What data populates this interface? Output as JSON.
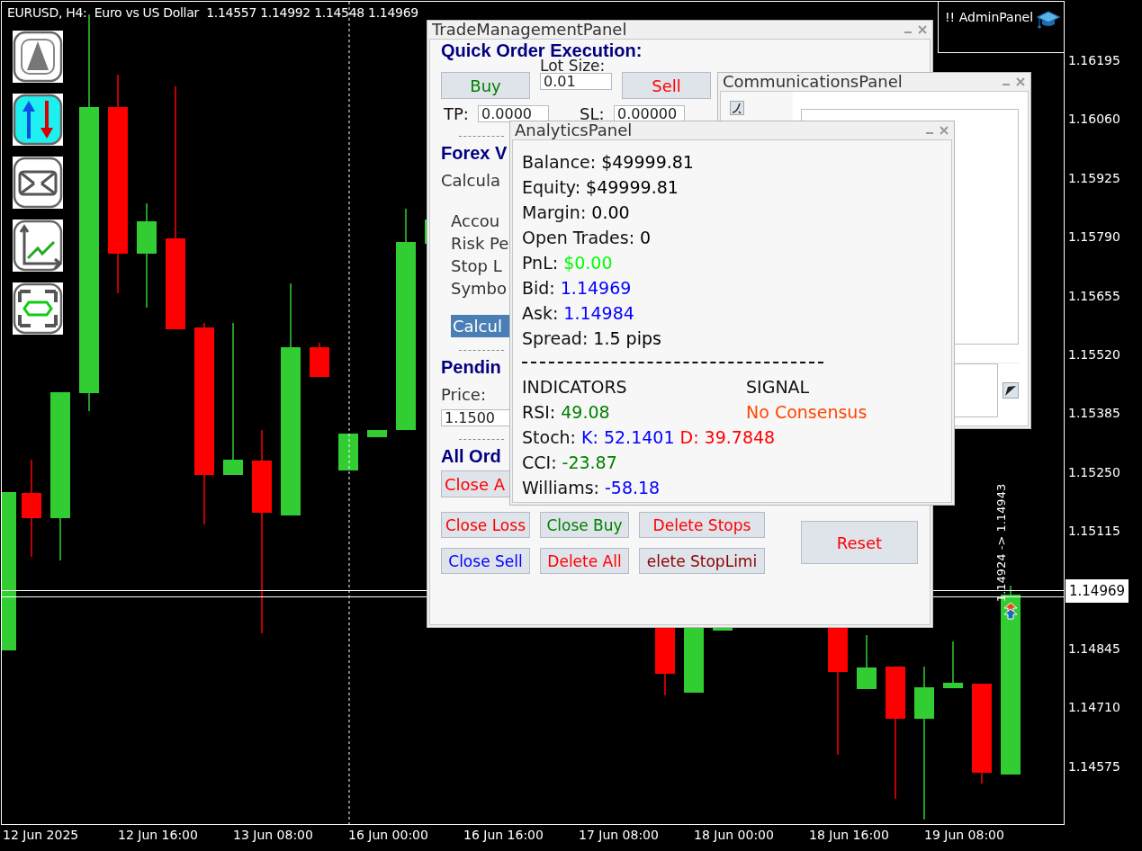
{
  "chart": {
    "header": "EURUSD, H4:  Euro vs US Dollar  1.14557 1.14992 1.14548 1.14969",
    "admin_label": "!! AdminPanel",
    "price_labels": [
      "1.16195",
      "1.16060",
      "1.15925",
      "1.15790",
      "1.15655",
      "1.15520",
      "1.15385",
      "1.15250",
      "1.15115",
      "1.14845",
      "1.14710",
      "1.14575"
    ],
    "current_price": "1.14969",
    "trade_line_label": "1.14924 -> 1.14943",
    "time_labels": [
      "12 Jun 2025",
      "12 Jun 16:00",
      "13 Jun 08:00",
      "16 Jun 00:00",
      "16 Jun 16:00",
      "17 Jun 08:00",
      "18 Jun 00:00",
      "18 Jun 16:00",
      "19 Jun 08:00"
    ]
  },
  "toolbar": [
    {
      "kind": "up",
      "selected": false
    },
    {
      "kind": "updown",
      "selected": true
    },
    {
      "kind": "mail",
      "selected": false
    },
    {
      "kind": "chart",
      "selected": false
    },
    {
      "kind": "expand",
      "selected": false
    }
  ],
  "trade_panel": {
    "title": "TradeManagementPanel",
    "heading": "Quick Order Execution:",
    "lot_label": "Lot Size:",
    "lot_value": "0.01",
    "buy": {
      "label": "Buy",
      "color": "#008000"
    },
    "sell": {
      "label": "Sell",
      "color": "#ff0000"
    },
    "tp_label": "TP:",
    "tp_value": "0.0000",
    "sl_label": "SL:",
    "sl_value": "0.00000",
    "forex_heading": "Forex V",
    "calc_label": "Calcula",
    "calc_items": [
      "Accou",
      "Risk Pe",
      "Stop L",
      "Symbo"
    ],
    "calc_button": "Calcul",
    "pending_heading": "Pendin",
    "price_label": "Price:",
    "price_value": "1.1500",
    "orders_heading": "All Ord",
    "close_all": {
      "label": "Close A",
      "color": "#ff0000"
    },
    "order_buttons": [
      {
        "label": "Close Loss",
        "color": "#ff0000"
      },
      {
        "label": "Close Buy",
        "color": "#008000"
      },
      {
        "label": "Delete Stops",
        "color": "#ff0000"
      },
      {
        "label": "Close Sell",
        "color": "#0000ff"
      },
      {
        "label": "Delete All",
        "color": "#ff0000"
      },
      {
        "label": "elete StopLimi",
        "color": "#8b0000"
      }
    ],
    "reset": {
      "label": "Reset",
      "color": "#ff0000"
    }
  },
  "communications_panel": {
    "title": "CommunicationsPanel"
  },
  "analytics_panel": {
    "title": "AnalyticsPanel",
    "lines": [
      {
        "label": "Balance:",
        "value": "$49999.81",
        "color": "#000000"
      },
      {
        "label": "Equity:",
        "value": "$49999.81",
        "color": "#000000"
      },
      {
        "label": "Margin:",
        "value": "0.00",
        "color": "#000000"
      },
      {
        "label": "Open Trades:",
        "value": "0",
        "color": "#000000"
      },
      {
        "label": "PnL:",
        "value": "$0.00",
        "color": "#00ff00"
      },
      {
        "label": "Bid:",
        "value": "1.14969",
        "color": "#0000ff"
      },
      {
        "label": "Ask:",
        "value": "1.14984",
        "color": "#0000ff"
      },
      {
        "label": "Spread:",
        "value": "1.5 pips",
        "color": "#000000"
      }
    ],
    "indicators_header": "INDICATORS",
    "signal_header": "SIGNAL",
    "signal": {
      "text": "No Consensus",
      "color": "#ff4500"
    },
    "indicators": [
      {
        "label": "RSI:",
        "values": [
          {
            "text": "49.08",
            "color": "#008000"
          }
        ]
      },
      {
        "label": "Stoch:",
        "values": [
          {
            "text": "K: 52.1401",
            "color": "#0000ff"
          },
          {
            "text": "D: 39.7848",
            "color": "#ff0000"
          }
        ]
      },
      {
        "label": "CCI:",
        "values": [
          {
            "text": "-23.87",
            "color": "#008000"
          }
        ]
      },
      {
        "label": "Williams:",
        "values": [
          {
            "text": "-58.18",
            "color": "#0000ff"
          }
        ]
      }
    ]
  }
}
